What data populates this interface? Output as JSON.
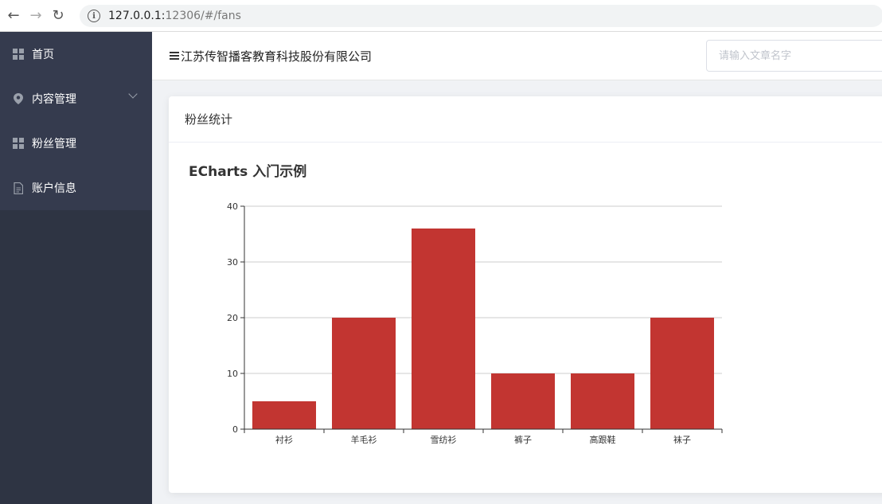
{
  "browser": {
    "back": "←",
    "forward": "→",
    "reload": "↻",
    "info": "i",
    "url_host": "127.0.0.1:",
    "url_rest": "12306/#/fans"
  },
  "sidebar": {
    "items": [
      {
        "label": "首页",
        "icon": "grid-icon"
      },
      {
        "label": "内容管理",
        "icon": "location-icon"
      },
      {
        "label": "粉丝管理",
        "icon": "grid-icon"
      },
      {
        "label": "账户信息",
        "icon": "document-icon"
      }
    ]
  },
  "header": {
    "company": "江苏传智播客教育科技股份有限公司",
    "search_placeholder": "请输入文章名字"
  },
  "card": {
    "title": "粉丝统计",
    "chart_title": "ECharts 入门示例"
  },
  "colors": {
    "bar": "#c23531",
    "sidebar": "#2e3443",
    "menu": "#353b4e"
  },
  "chart_data": {
    "type": "bar",
    "title": "ECharts 入门示例",
    "categories": [
      "衬衫",
      "羊毛衫",
      "雪纺衫",
      "裤子",
      "高跟鞋",
      "袜子"
    ],
    "values": [
      5,
      20,
      36,
      10,
      10,
      20
    ],
    "ylim": [
      0,
      40
    ],
    "yticks": [
      0,
      10,
      20,
      30,
      40
    ],
    "grid": true
  }
}
